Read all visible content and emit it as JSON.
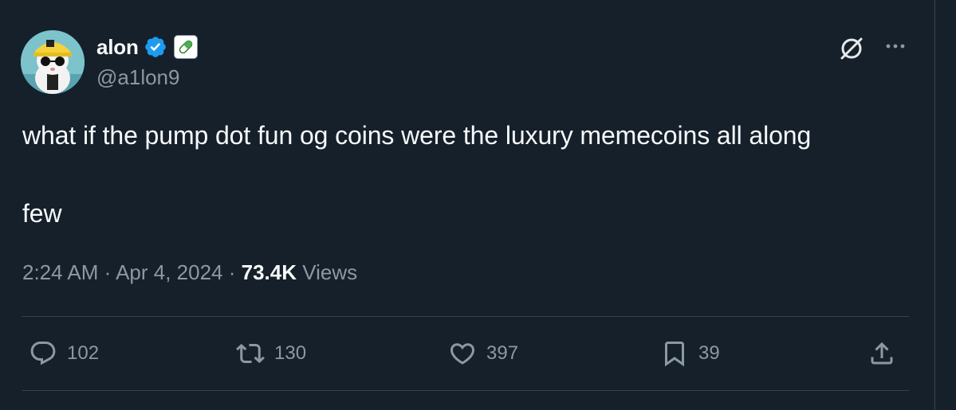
{
  "author": {
    "display_name": "alon",
    "handle": "@a1lon9",
    "verified": true,
    "affiliate_badge_icon": "green-pill-icon"
  },
  "tweet": {
    "lines": [
      "what if the pump dot fun og coins were the luxury memecoins all along",
      "few"
    ],
    "time": "2:24 AM",
    "separator": " · ",
    "date": "Apr 4, 2024",
    "views_count": "73.4K",
    "views_label": "Views"
  },
  "actions": {
    "replies": "102",
    "retweets": "130",
    "likes": "397",
    "bookmarks": "39"
  },
  "colors": {
    "background": "#15202b",
    "text": "#f7f9f9",
    "muted": "#8b98a5",
    "divider": "#38444d",
    "verified": "#1d9bf0"
  }
}
